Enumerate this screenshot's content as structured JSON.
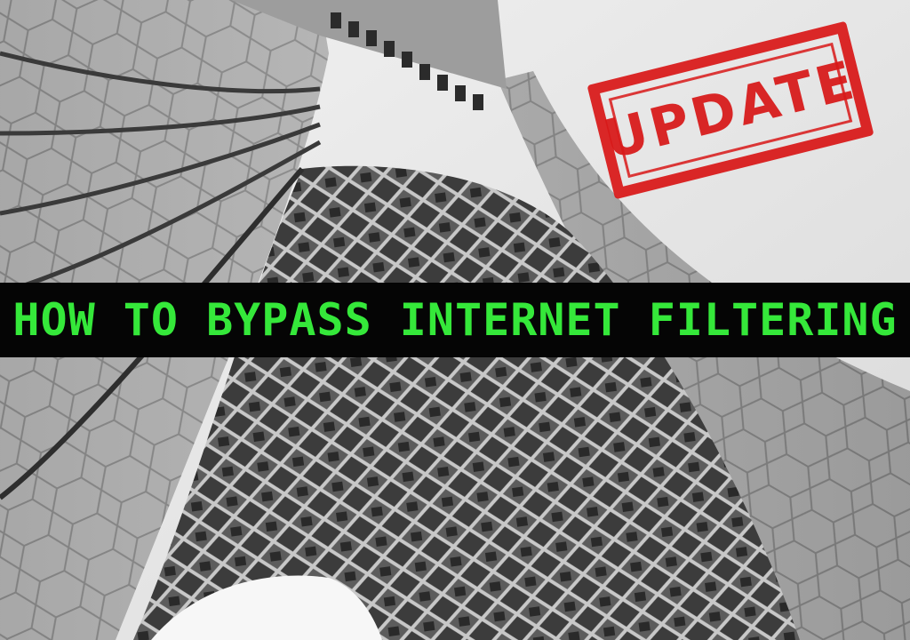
{
  "banner": {
    "headline": "HOW TO BYPASS INTERNET FILTERING",
    "text_color": "#35e83a",
    "background_color": "#050505"
  },
  "stamp": {
    "label": "UPDATE",
    "color": "#d81818"
  },
  "photo": {
    "subject": "monument-underside-photo",
    "palette": "grayscale"
  }
}
